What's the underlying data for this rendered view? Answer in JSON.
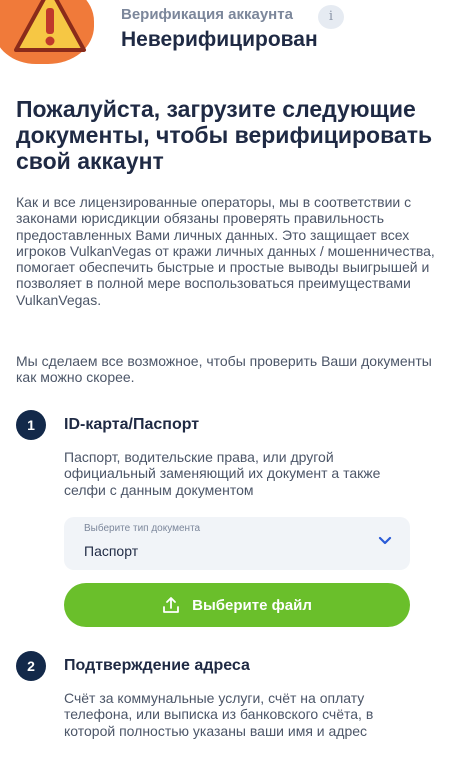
{
  "header": {
    "status_title": "Верификация аккаунта",
    "status_value": "Неверифицирован",
    "info_icon": "i"
  },
  "main": {
    "headline": "Пожалуйста, загрузите следующие документы, чтобы верифицировать свой аккаунт",
    "intro": "Как и все лицензированные операторы, мы в соответствии с законами юрисдикции обязаны проверять правильность предоставленных Вами личных данных. Это защищает всех игроков VulkanVegas от кражи личных данных / мошенничества, помогает обеспечить быстрые и простые выводы выигрышей и позволяет в полной мере воспользоваться преимуществами VulkanVegas.",
    "promise": "Мы сделаем все возможное, чтобы проверить Ваши документы как можно скорее."
  },
  "steps": [
    {
      "number": "1",
      "title": "ID-карта/Паспорт",
      "description": "Паспорт, водительские права, или другой официальный заменяющий их документ а также селфи с данным документом",
      "select_label": "Выберите тип документа",
      "select_value": "Паспорт",
      "button_label": "Выберите файл"
    },
    {
      "number": "2",
      "title": "Подтверждение адреса",
      "description": "Счёт за коммунальные услуги, счёт на оплату телефона, или выписка из банковского счёта, в которой полностью указаны ваши имя и адрес"
    }
  ],
  "colors": {
    "accent_green": "#6abf2b",
    "warning_orange": "#f07a3a",
    "navy": "#13294a"
  },
  "icons": [
    "warning-icon",
    "info-icon",
    "chevron-down-icon",
    "upload-icon"
  ]
}
